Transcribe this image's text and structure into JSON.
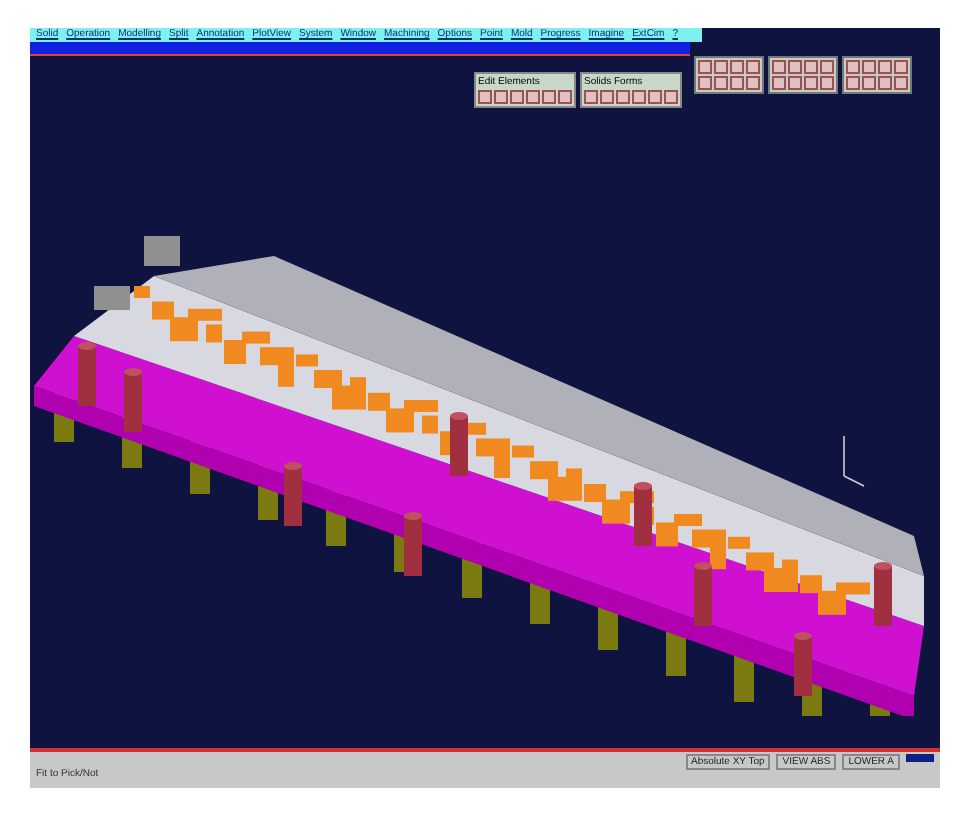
{
  "menu": [
    "Solid",
    "Operation",
    "Modelling",
    "Split",
    "Annotation",
    "PlotView",
    "System",
    "Window",
    "Machining",
    "Options",
    "Point",
    "Mold",
    "Progress",
    "Imagine",
    "ExtCim",
    "?"
  ],
  "toolbars": [
    {
      "title": "Edit Elements"
    },
    {
      "title": "Solids Forms"
    }
  ],
  "status_bar": {
    "message": "Fit to Pick/Not",
    "fields": [
      "Absolute XY Top",
      "VIEW ABS",
      "LOWER A"
    ]
  }
}
